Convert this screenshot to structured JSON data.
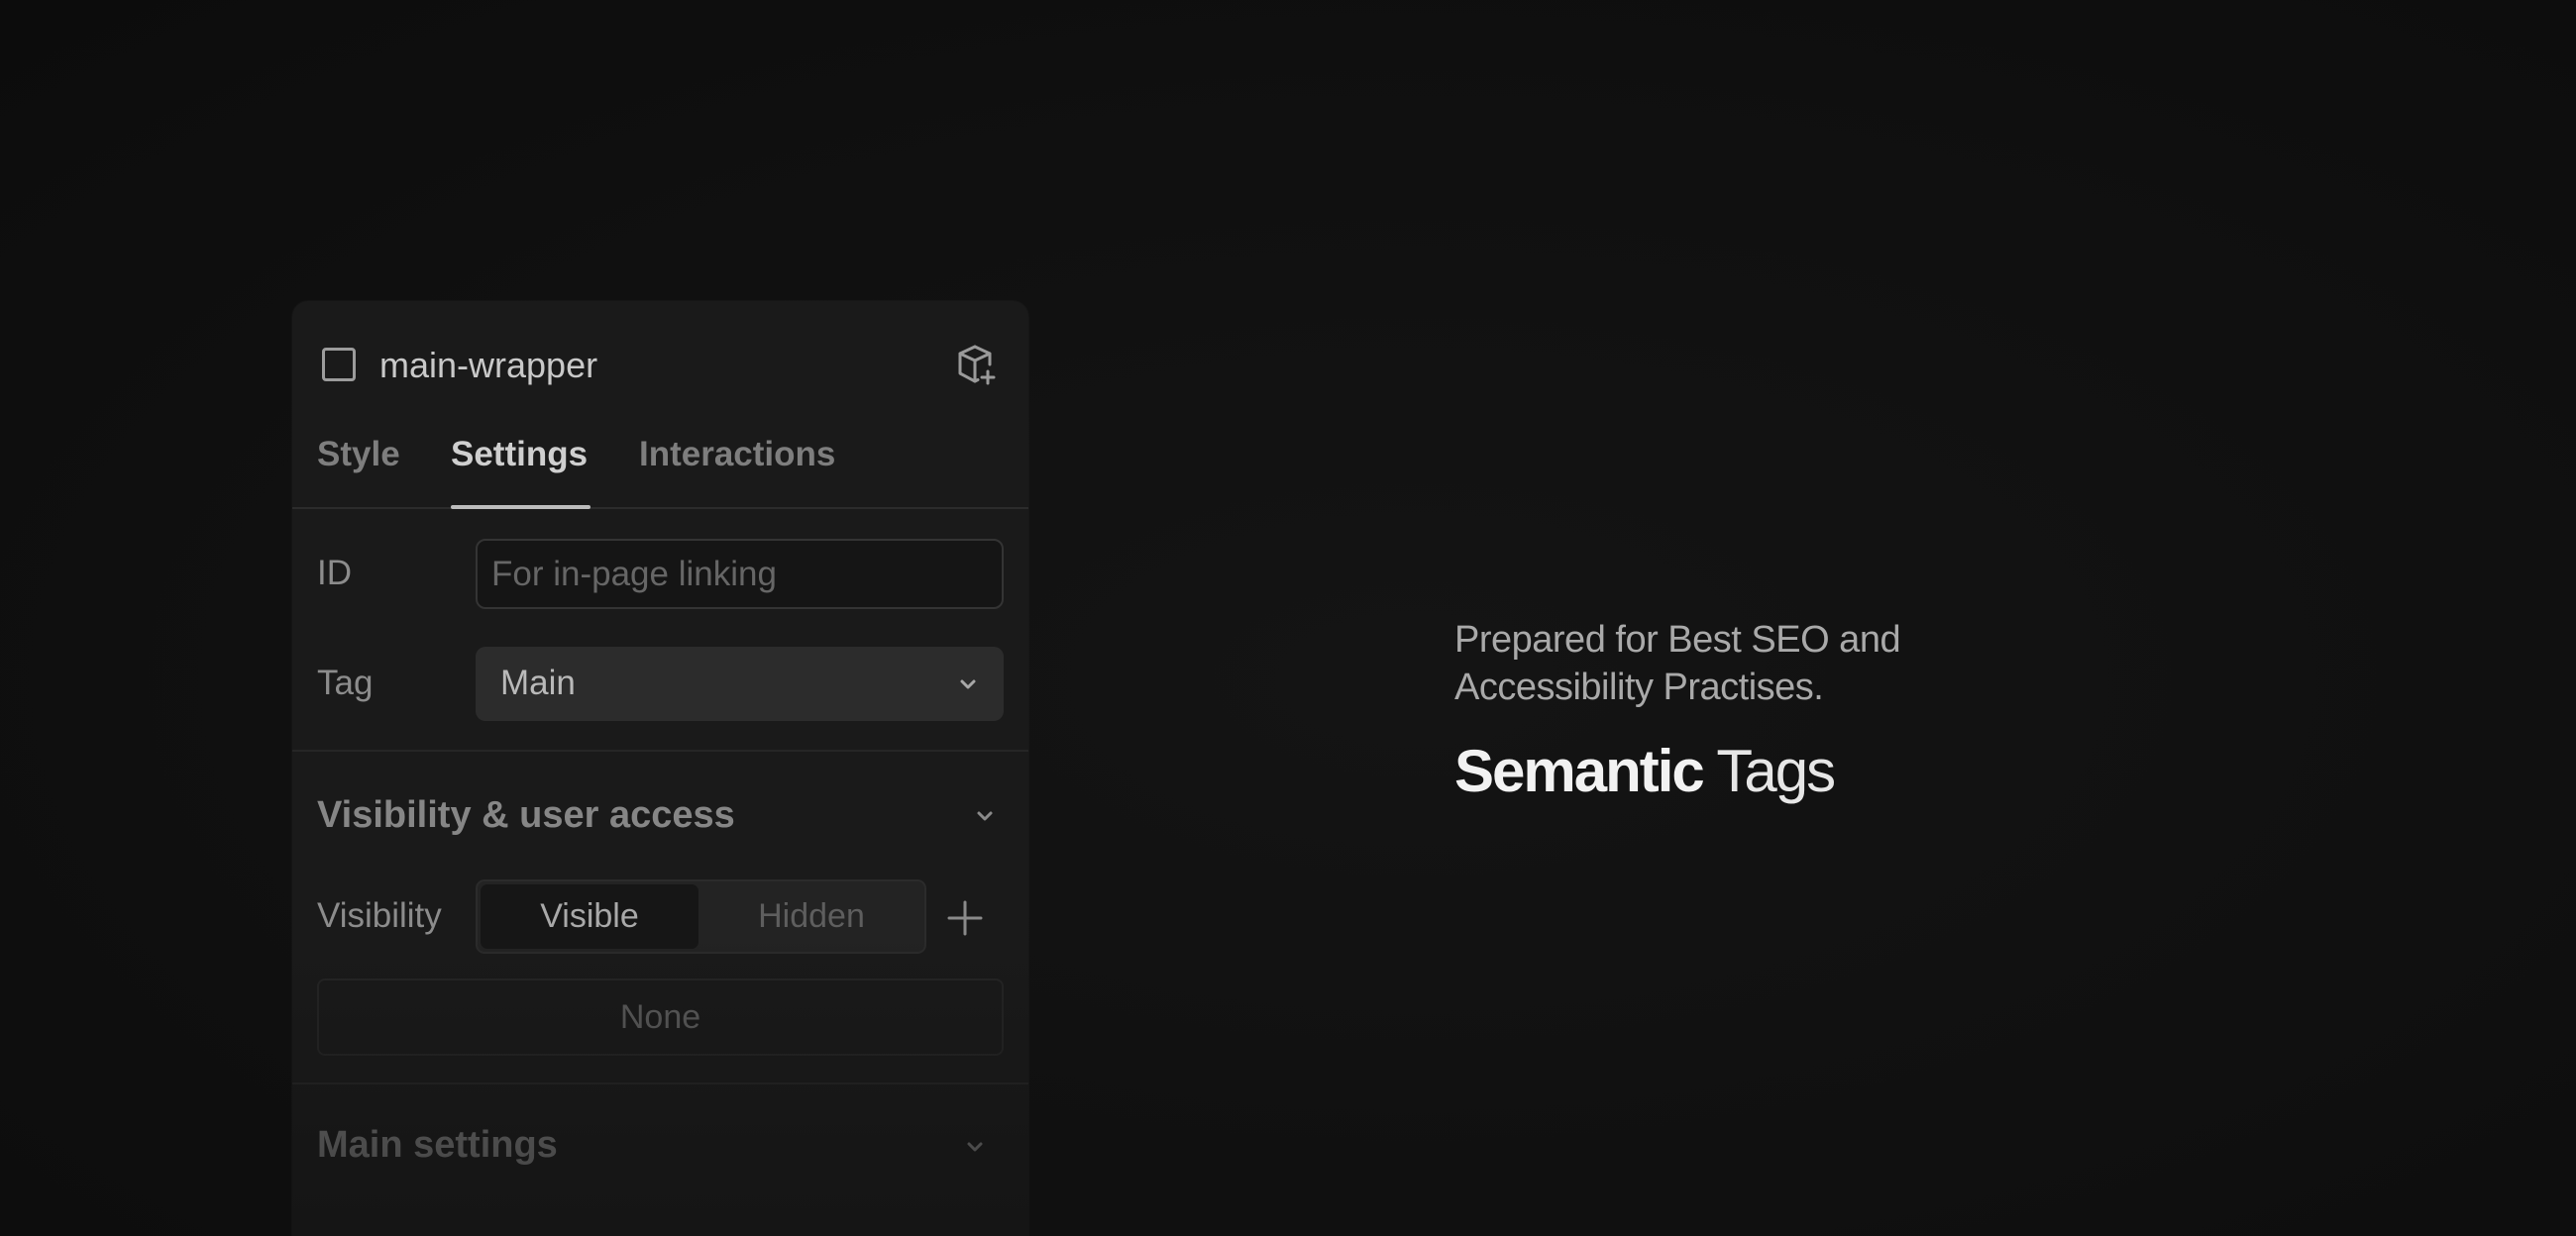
{
  "panel": {
    "element_name": "main-wrapper",
    "tabs": [
      {
        "label": "Style"
      },
      {
        "label": "Settings"
      },
      {
        "label": "Interactions"
      }
    ],
    "active_tab": "Settings",
    "id_field": {
      "label": "ID",
      "value": "",
      "placeholder": "For in-page linking"
    },
    "tag_field": {
      "label": "Tag",
      "value": "Main"
    },
    "visibility_section": {
      "title": "Visibility & user access",
      "visibility_label": "Visibility",
      "options": [
        "Visible",
        "Hidden"
      ],
      "selected": "Visible",
      "none_label": "None"
    },
    "main_settings_section": {
      "title": "Main settings"
    }
  },
  "promo": {
    "line1": "Prepared for Best SEO and",
    "line2": "Accessibility Practises.",
    "headline_bold": "Semantic",
    "headline_light": "Tags"
  },
  "icons": {
    "element": "square-outline-icon",
    "component": "cube-plus-icon",
    "chevron": "chevron-down-icon",
    "add": "plus-icon"
  }
}
